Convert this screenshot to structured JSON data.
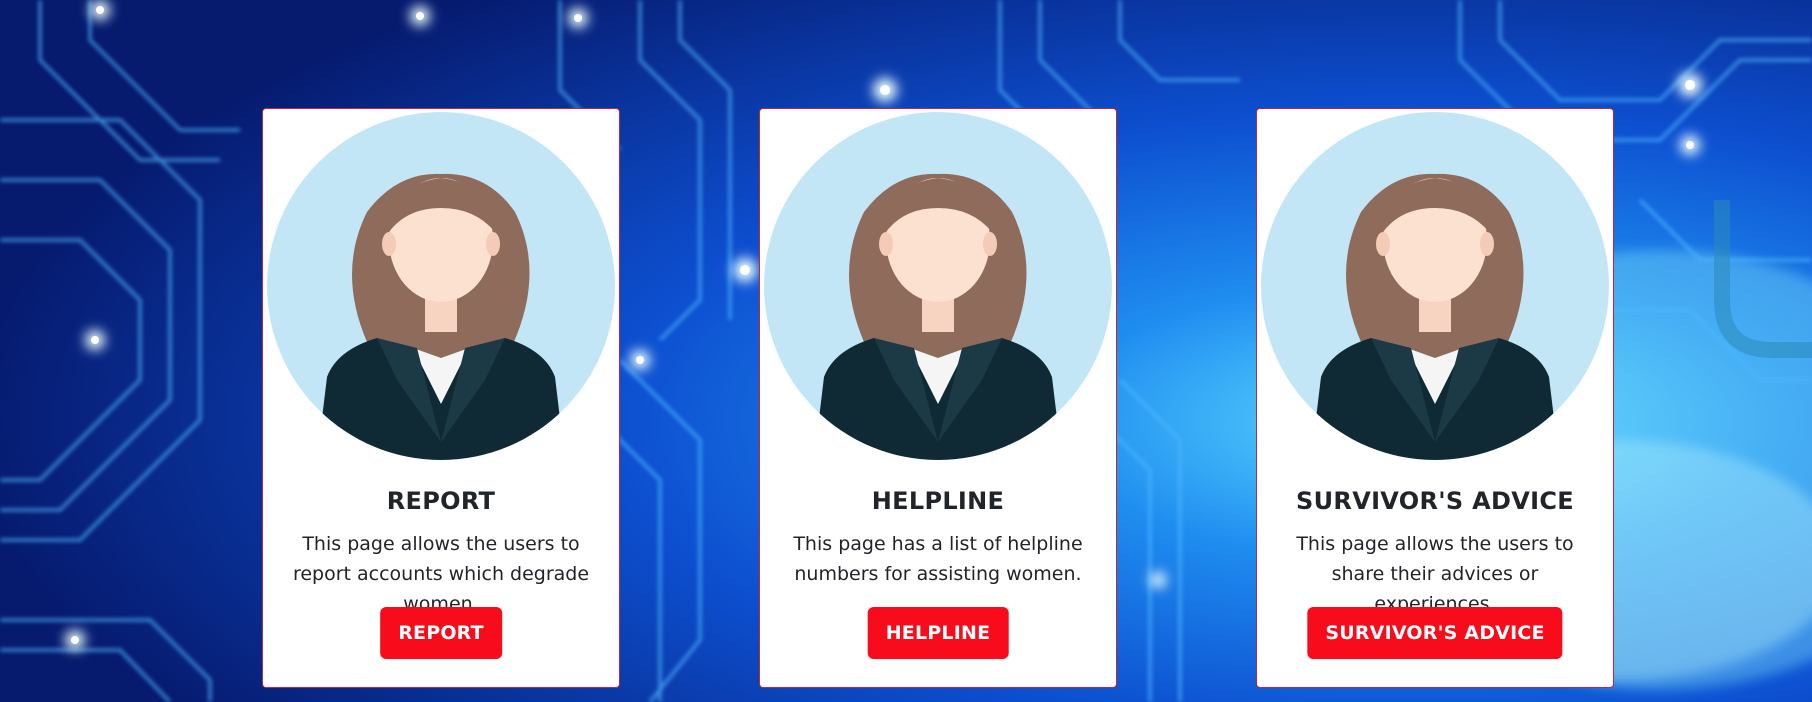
{
  "cards": [
    {
      "title": "REPORT",
      "description": "This page allows the users to report accounts which degrade women.",
      "button_label": "REPORT"
    },
    {
      "title": "HELPLINE",
      "description": "This page has a list of helpline numbers for assisting women.",
      "button_label": "HELPLINE"
    },
    {
      "title": "SURVIVOR'S ADVICE",
      "description": "This page allows the users to share their advices or experiences.",
      "button_label": "SURVIVOR'S ADVICE"
    }
  ],
  "colors": {
    "button": "#f80b1a",
    "card_border": "#c1272d",
    "avatar_circle": "#c3e6f6"
  },
  "icons": [
    "woman-avatar-icon"
  ]
}
